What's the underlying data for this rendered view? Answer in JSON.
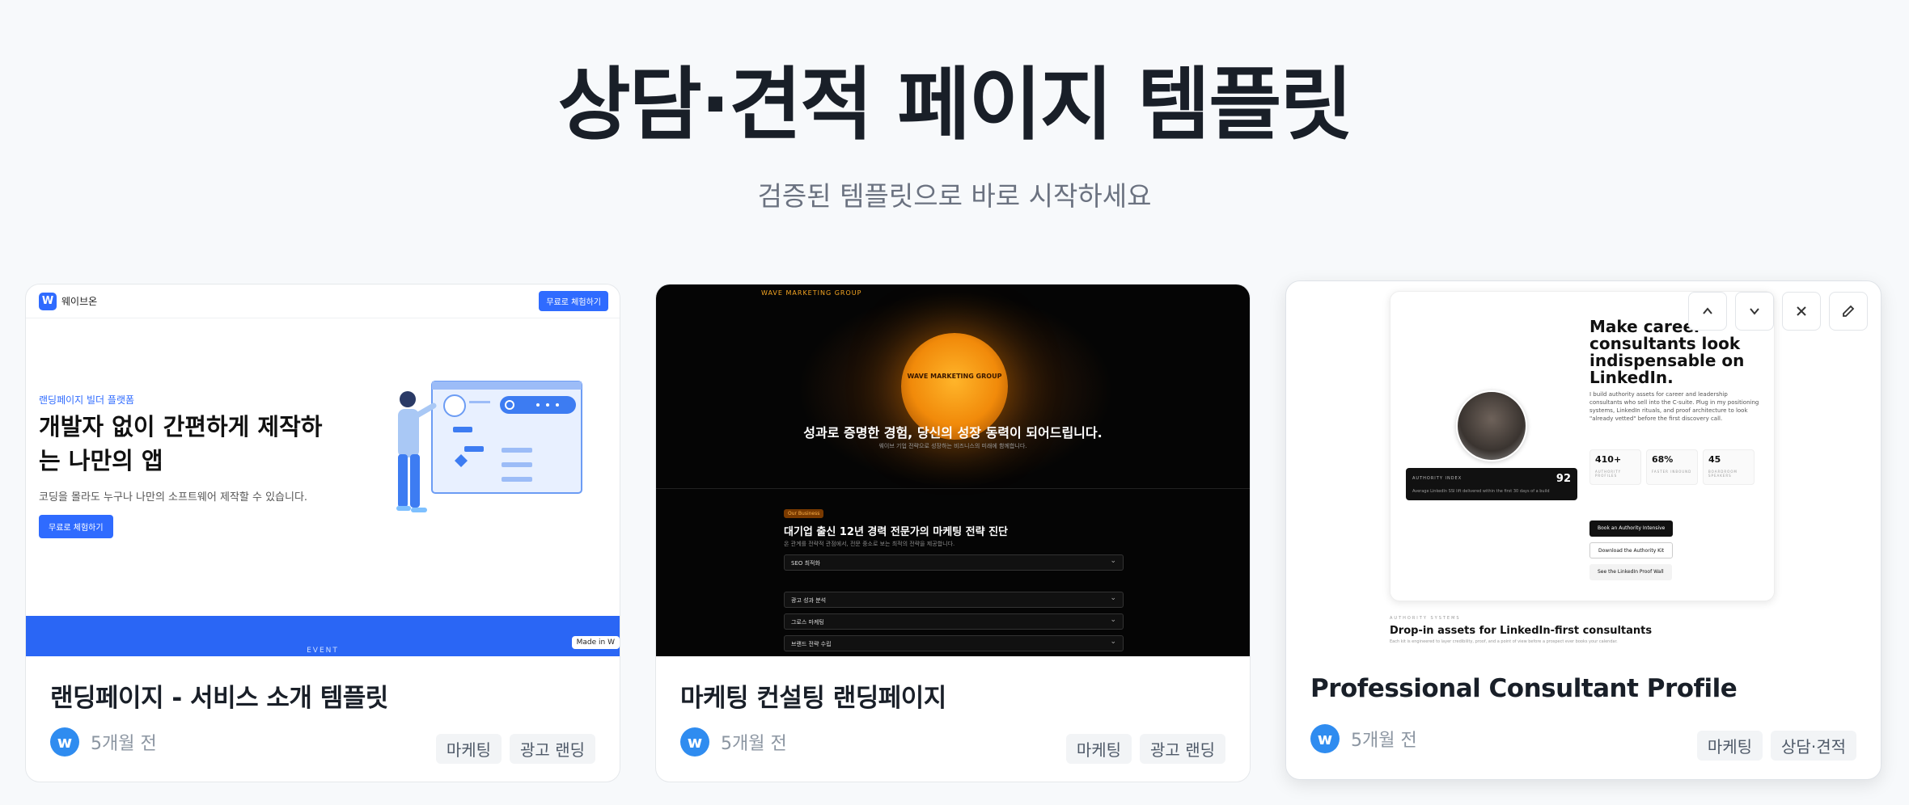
{
  "header": {
    "title": "상담·견적 페이지 템플릿",
    "subtitle": "검증된 템플릿으로 바로 시작하세요"
  },
  "cards": [
    {
      "title": "랜딩페이지 - 서비스 소개 템플릿",
      "time": "5개월 전",
      "avatar": "w",
      "tags": [
        "마케팅",
        "광고 랜딩"
      ],
      "thumb": {
        "logo": "W",
        "brand": "웨이브온",
        "nav_button": "무료로 체험하기",
        "eyebrow": "랜딩페이지 빌더 플랫폼",
        "headline": "개발자 없이 간편하게 제작하는 나만의 앱",
        "sub": "코딩을 몰라도 누구나 나만의 소프트웨어 제작할 수 있습니다.",
        "cta": "무료로 체험하기",
        "band_label": "EVENT",
        "made_badge": "Made in W"
      }
    },
    {
      "title": "마케팅 컨설팅 랜딩페이지",
      "time": "5개월 전",
      "avatar": "w",
      "tags": [
        "마케팅",
        "광고 랜딩"
      ],
      "thumb": {
        "brand": "WAVE MARKETING GROUP",
        "orb_text": "WAVE MARKETING GROUP",
        "headline": "성과로 증명한 경험, 당신의 성장 동력이 되어드립니다.",
        "sub": "웨이브 기업 전략으로 성장하는 비즈니스의 미래에 함께합니다.",
        "badge": "Our Business",
        "section_title": "대기업 출신 12년 경력 전문가의 마케팅 전략 진단",
        "section_sub": "온 관계를 전략적 관점에서, 전문 중소로 보는 최적의 전략을 제공합니다.",
        "accordion": [
          "SEO 최적화",
          "광고 성과 분석",
          "그로스 마케팅",
          "브랜드 전략 수립"
        ]
      }
    },
    {
      "title": "Professional Consultant Profile",
      "time": "5개월 전",
      "avatar": "w",
      "tags": [
        "마케팅",
        "상담·견적"
      ],
      "thumb": {
        "headline": "Make career consultants look indispensable on LinkedIn.",
        "desc": "I build authority assets for career and leadership consultants who sell into the C-suite. Plug in my positioning systems, LinkedIn rituals, and proof architecture to look \"already vetted\" before the first discovery call.",
        "authority_label": "AUTHORITY INDEX",
        "authority_value": "92",
        "authority_sub": "Average LinkedIn SSI lift delivered within the first 30 days of a build",
        "stats": [
          {
            "value": "410+",
            "label": "AUTHORITY PROFILES"
          },
          {
            "value": "68%",
            "label": "FASTER INBOUND"
          },
          {
            "value": "45",
            "label": "BOARDROOM SPEAKERS"
          }
        ],
        "btn_primary": "Book an Authority Intensive",
        "btn_secondary": "Download the Authority Kit",
        "btn_tertiary": "See the LinkedIn Proof Wall",
        "eyebrow": "AUTHORITY SYSTEMS",
        "section_title": "Drop-in assets for LinkedIn-first consultants",
        "section_sub": "Each kit is engineered to layer credibility, proof, and a point of view before a prospect ever books your calendar."
      },
      "toolbar": [
        "chevron-up-icon",
        "chevron-down-icon",
        "close-icon",
        "edit-icon"
      ]
    }
  ]
}
